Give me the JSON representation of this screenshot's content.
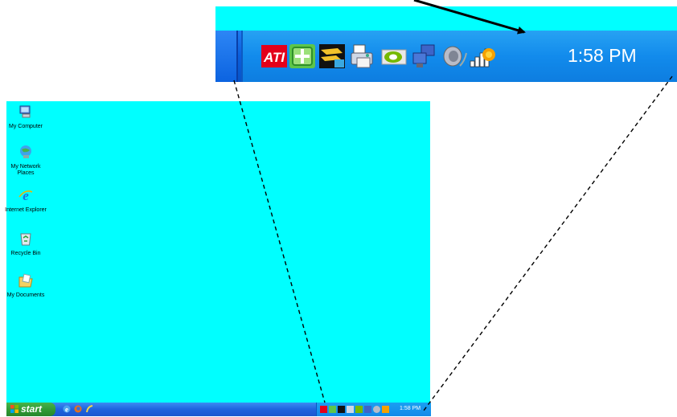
{
  "zoom": {
    "clock": "1:58 PM",
    "tray_icons": [
      "ati-icon",
      "shield-icon",
      "network-tool-icon",
      "printer-icon",
      "nvidia-icon",
      "network-computers-icon",
      "speaker-icon",
      "wireless-signal-icon"
    ]
  },
  "desktop": {
    "icons": [
      {
        "name": "my-computer-icon",
        "label": "My Computer"
      },
      {
        "name": "my-network-places-icon",
        "label": "My Network Places"
      },
      {
        "name": "internet-explorer-icon",
        "label": "Internet Explorer"
      },
      {
        "name": "recycle-bin-icon",
        "label": "Recycle Bin"
      },
      {
        "name": "my-documents-icon",
        "label": "My Documents"
      }
    ]
  },
  "taskbar": {
    "start_label": "start",
    "quick_launch": [
      "internet-explorer-icon",
      "firefox-icon",
      "media-icon"
    ],
    "clock": "1:58 PM"
  },
  "colors": {
    "desktop": "#00ffff",
    "taskbar": "#1f63de",
    "tray": "#1289e9",
    "start_button": "#2f9a34"
  }
}
